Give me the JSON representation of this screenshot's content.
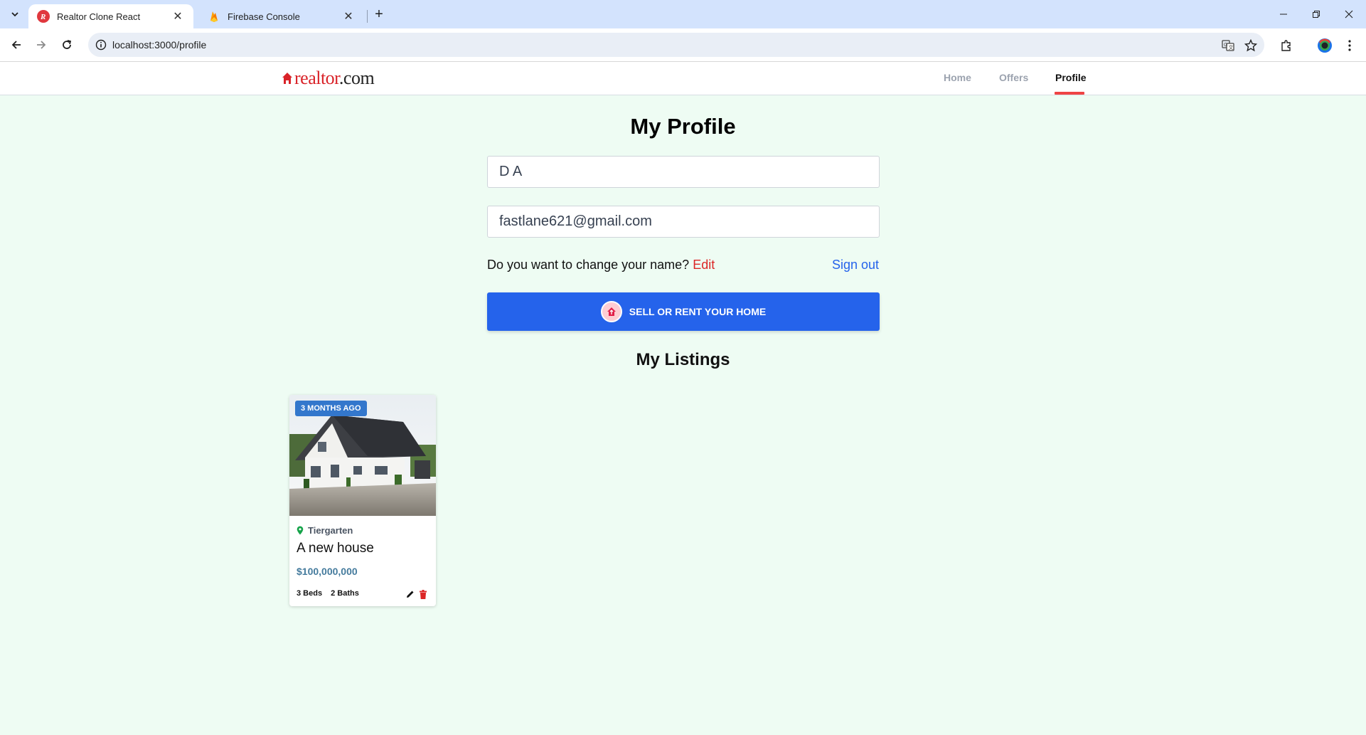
{
  "browser": {
    "tabs": [
      {
        "title": "Realtor Clone React",
        "active": true
      },
      {
        "title": "Firebase Console",
        "active": false
      }
    ],
    "url": "localhost:3000/profile"
  },
  "header": {
    "logo_main": "realtor",
    "logo_suffix": ".com",
    "nav": [
      {
        "label": "Home",
        "active": false
      },
      {
        "label": "Offers",
        "active": false
      },
      {
        "label": "Profile",
        "active": true
      }
    ]
  },
  "profile": {
    "title": "My Profile",
    "name_value": "D A",
    "email_value": "fastlane621@gmail.com",
    "change_name_prompt": "Do you want to change your name?",
    "edit_label": "Edit",
    "sign_out_label": "Sign out",
    "sell_button_label": "SELL OR RENT YOUR HOME"
  },
  "listings": {
    "title": "My Listings",
    "items": [
      {
        "badge": "3 MONTHS AGO",
        "location": "Tiergarten",
        "name": "A new house",
        "price": "$100,000,000",
        "beds": "3 Beds",
        "baths": "2 Baths"
      }
    ]
  },
  "colors": {
    "accent_blue": "#2563eb",
    "accent_red": "#ef4444",
    "page_bg": "#eefcf3"
  }
}
